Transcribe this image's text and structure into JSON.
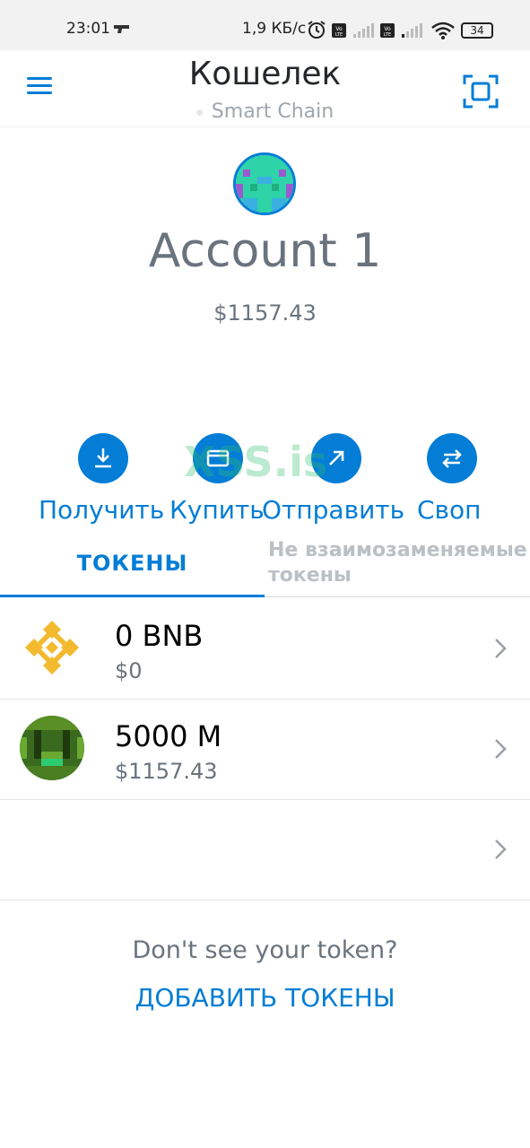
{
  "status_bar": {
    "time": "23:01",
    "network_speed": "1,9 КБ/с",
    "battery": "34"
  },
  "header": {
    "title": "Кошелек",
    "network": "Smart Chain"
  },
  "account": {
    "name": "Account 1",
    "balance": "$1157.43"
  },
  "actions": [
    {
      "label": "Получить",
      "icon": "receive-icon"
    },
    {
      "label": "Купить",
      "icon": "buy-card-icon"
    },
    {
      "label": "Отправить",
      "icon": "send-arrow-icon"
    },
    {
      "label": "Своп",
      "icon": "swap-icon"
    }
  ],
  "watermark": "XSS.is",
  "tabs": {
    "tokens": "ТОКЕНЫ",
    "nft": "Не взаимозаменяемые токены"
  },
  "tokens": [
    {
      "amount": "0 BNB",
      "fiat": "$0",
      "icon": "bnb-logo-icon"
    },
    {
      "amount": "5000 M",
      "fiat": "$1157.43",
      "icon": "pixel-token-icon"
    },
    {
      "amount": "",
      "fiat": "",
      "icon": ""
    }
  ],
  "footer": {
    "dont_see": "Don't see your token?",
    "add_tokens": "ДОБАВИТЬ ТОКЕНЫ"
  },
  "colors": {
    "accent": "#037dd6",
    "text_muted": "#6a737d",
    "bnb_yellow": "#f3ba2f"
  }
}
